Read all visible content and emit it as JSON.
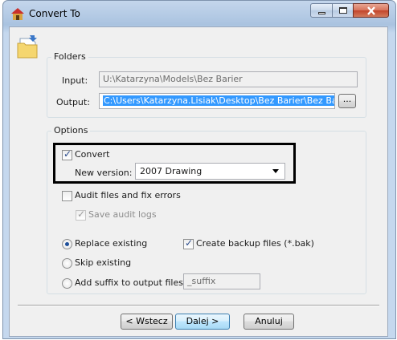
{
  "window": {
    "title": "Convert To"
  },
  "folders": {
    "label": "Folders",
    "input_label": "Input:",
    "input_value": "U:\\Katarzyna\\Models\\Bez Barier",
    "output_label": "Output:",
    "output_value": "C:\\Users\\Katarzyna.Lisiak\\Desktop\\Bez Barier\\Bez Barier",
    "browse_label": "..."
  },
  "options": {
    "label": "Options",
    "convert_label": "Convert",
    "convert_checked": true,
    "new_version_label": "New version:",
    "new_version_value": "2007 Drawing",
    "audit_label": "Audit files and fix errors",
    "save_audit_label": "Save audit logs",
    "replace_label": "Replace existing",
    "skip_label": "Skip existing",
    "suffix_label": "Add suffix to output files",
    "suffix_value": "_suffix",
    "backup_label": "Create backup files (*.bak)"
  },
  "buttons": {
    "back": "< Wstecz",
    "next": "Dalej >",
    "cancel": "Anuluj"
  }
}
